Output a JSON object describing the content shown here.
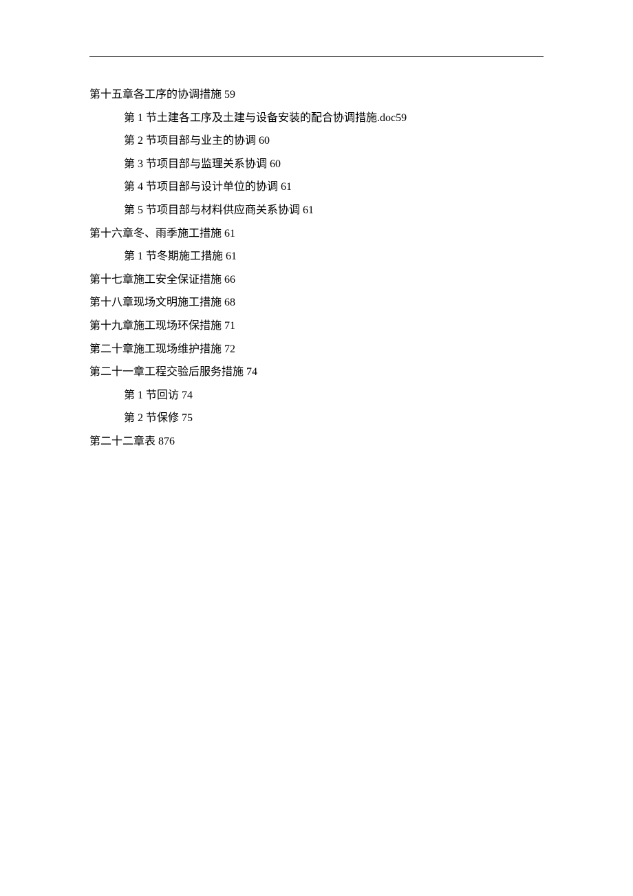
{
  "toc": [
    {
      "level": "chapter",
      "text": "第十五章各工序的协调措施 59"
    },
    {
      "level": "section",
      "text": "第 1 节土建各工序及土建与设备安装的配合协调措施.doc59"
    },
    {
      "level": "section",
      "text": "第 2 节项目部与业主的协调 60"
    },
    {
      "level": "section",
      "text": "第 3 节项目部与监理关系协调 60"
    },
    {
      "level": "section",
      "text": "第 4 节项目部与设计单位的协调 61"
    },
    {
      "level": "section",
      "text": "第 5 节项目部与材料供应商关系协调 61"
    },
    {
      "level": "chapter",
      "text": "第十六章冬、雨季施工措施 61"
    },
    {
      "level": "section",
      "text": "第 1 节冬期施工措施 61"
    },
    {
      "level": "chapter",
      "text": "第十七章施工安全保证措施 66"
    },
    {
      "level": "chapter",
      "text": "第十八章现场文明施工措施 68"
    },
    {
      "level": "chapter",
      "text": "第十九章施工现场环保措施 71"
    },
    {
      "level": "chapter",
      "text": "第二十章施工现场维护措施 72"
    },
    {
      "level": "chapter",
      "text": "第二十一章工程交验后服务措施 74"
    },
    {
      "level": "section",
      "text": "第 1 节回访 74"
    },
    {
      "level": "section",
      "text": "第 2 节保修 75"
    },
    {
      "level": "chapter",
      "text": "第二十二章表 876"
    }
  ]
}
